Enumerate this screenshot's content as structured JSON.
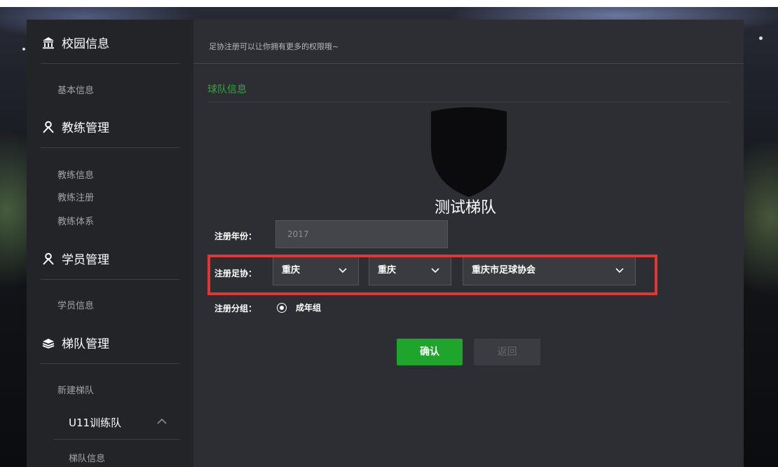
{
  "sidebar": {
    "campus": {
      "title": "校园信息",
      "items": [
        "基本信息"
      ]
    },
    "coach": {
      "title": "教练管理",
      "items": [
        "教练信息",
        "教练注册",
        "教练体系"
      ]
    },
    "student": {
      "title": "学员管理",
      "items": [
        "学员信息"
      ]
    },
    "team": {
      "title": "梯队管理",
      "items": [
        "新建梯队"
      ],
      "current_team": "U11训练队",
      "current_team_items": [
        "梯队信息"
      ]
    }
  },
  "main": {
    "tip": "足协注册可以让你拥有更多的权限哦~",
    "section_title": "球队信息",
    "team_name": "测试梯队",
    "form": {
      "year_label": "注册年份：",
      "year_value": "2017",
      "assoc_label": "注册足协：",
      "select_1": "重庆",
      "select_2": "重庆",
      "select_3": "重庆市足球协会",
      "group_label": "注册分组：",
      "group_option": "成年组"
    },
    "buttons": {
      "confirm": "确认",
      "back": "返回"
    }
  },
  "colors": {
    "accent_green": "#1fa52c",
    "section_green": "#2faa3b",
    "highlight_red": "#e13636",
    "sidebar_bg": "#232428",
    "main_bg": "#2d2e33"
  }
}
